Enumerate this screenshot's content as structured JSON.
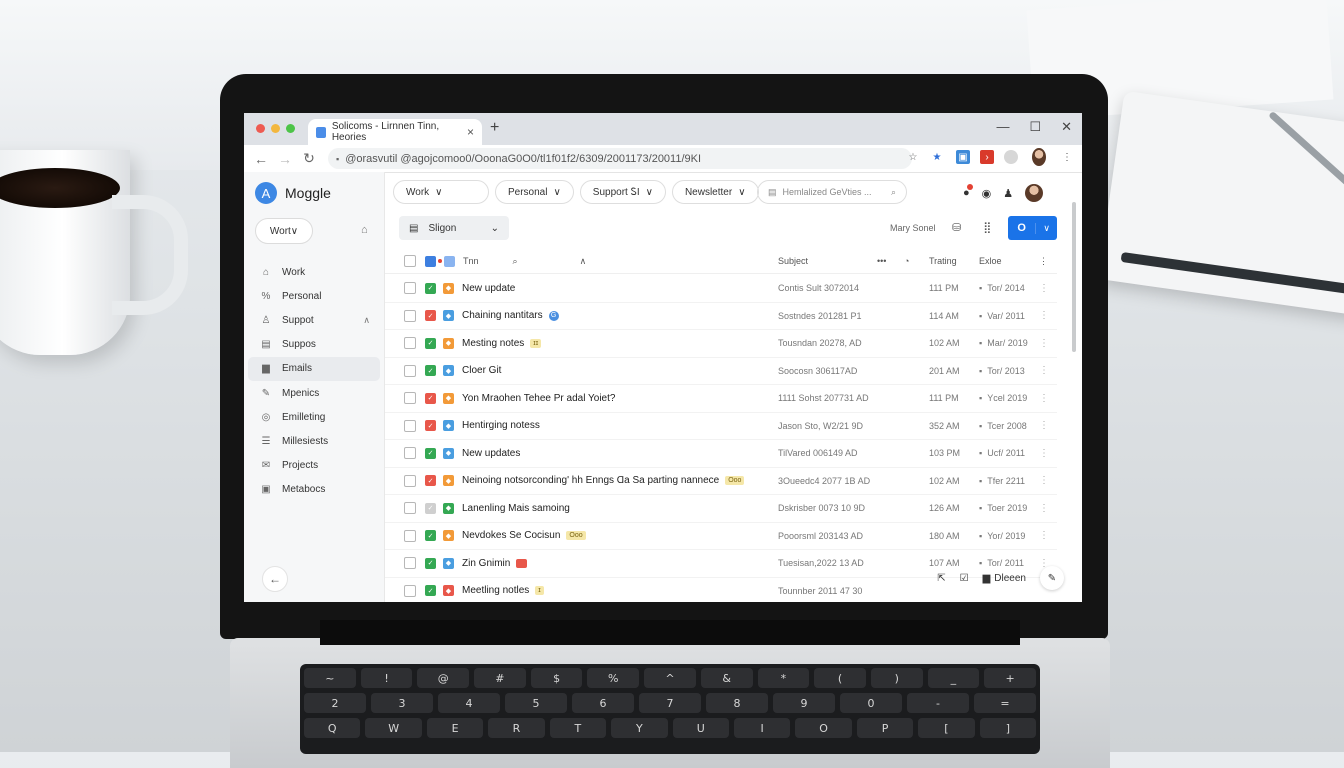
{
  "browser": {
    "tab_title": "Solicoms - Lirnnen Tinn, Heories",
    "tab_close": "×",
    "new_tab": "+",
    "address": "@orasvutil @agojcomoo0/OoonaG0O0/tl1f01f2/6309/2001173/20011/9KI",
    "window_controls": [
      "—",
      "☐",
      "✕"
    ]
  },
  "sidebar": {
    "brand_letter": "A",
    "brand_name": "Moggle",
    "account_label": "Wort∨",
    "items": [
      {
        "label": "Work",
        "icon": "⌂"
      },
      {
        "label": "Personal",
        "icon": "%"
      },
      {
        "label": "Suppot",
        "icon": "♙",
        "chevron": "∧"
      },
      {
        "label": "Suppos",
        "icon": "▤"
      },
      {
        "label": "Emails",
        "icon": "▆"
      },
      {
        "label": "Mpenics",
        "icon": "✎"
      },
      {
        "label": "Emilleting",
        "icon": "◎"
      },
      {
        "label": "Millesiests",
        "icon": "☰"
      },
      {
        "label": "Projects",
        "icon": "✉"
      },
      {
        "label": "Metabocs",
        "icon": "▣"
      }
    ],
    "back": "←"
  },
  "filters": [
    {
      "label": "Work",
      "chev": "∨"
    },
    {
      "label": "Personal",
      "chev": "∨"
    },
    {
      "label": "Support ᏚΙ",
      "chev": "∨"
    },
    {
      "label": "Newsletter",
      "chev": "∨"
    }
  ],
  "search": {
    "placeholder": "Hemlalized GeVties ..."
  },
  "toolbar": {
    "label": "Sligon",
    "may_send": "Mary Sonel",
    "primary_label": "O",
    "primary_chev": "∨"
  },
  "table": {
    "headers": {
      "name": "Tnn",
      "subject": "Subject",
      "date": "Trating",
      "expires": "Exloe"
    },
    "rows": [
      {
        "subject": "New update",
        "date": "Contis Sult 3072014",
        "time": "111 PM",
        "exp": "Tor/ 2014",
        "c1": "#34a853",
        "c2": "#f29a38"
      },
      {
        "subject": "Chaining nantitars",
        "date": "Sostndes 201281 P1",
        "time": "114 AM",
        "exp": "Var/ 2011",
        "c1": "#e8574a",
        "c2": "#4a9ee0"
      },
      {
        "subject": "Mesting notes",
        "date": "Tousndan 20278, AD",
        "time": "102 AM",
        "exp": "Mar/ 2019",
        "c1": "#34a853",
        "c2": "#f29a38"
      },
      {
        "subject": "Cloer Git",
        "date": "Soocosn 306117AD",
        "time": "201 AM",
        "exp": "Tor/ 2013",
        "c1": "#34a853",
        "c2": "#4a9ee0"
      },
      {
        "subject": "Yon Mraohen Tehee Pr adal Yoiet?",
        "date": "1111 Sohst 207731 AD",
        "time": "111 PM",
        "exp": "Ycel 2019",
        "c1": "#e8574a",
        "c2": "#f29a38"
      },
      {
        "subject": "Hentirging notess",
        "date": "Jason Sto, W2/21 9D",
        "time": "352 AM",
        "exp": "Tcer 2008",
        "c1": "#e8574a",
        "c2": "#4a9ee0"
      },
      {
        "subject": "New updates",
        "date": "TilVared 006149 AD",
        "time": "103 PM",
        "exp": "Ucf/ 2011",
        "c1": "#34a853",
        "c2": "#4a9ee0"
      },
      {
        "subject": "Neinoing notsorconding' hh Enngs Ɑa Sa parting nannece",
        "date": "3Oueedc4 2077 1B AD",
        "time": "102 AM",
        "exp": "Tfer 2211",
        "c1": "#e8574a",
        "c2": "#f29a38"
      },
      {
        "subject": "Lanenling Mais samoing",
        "date": "Dskrisber 0073 10 9D",
        "time": "126 AM",
        "exp": "Toer 2019",
        "c1": "#cfcfcf",
        "c2": "#34a853"
      },
      {
        "subject": "Nevdokes Se Cocisun",
        "date": "Pooorsml 203143 AD",
        "time": "180 AM",
        "exp": "Yor/ 2019",
        "c1": "#34a853",
        "c2": "#f29a38"
      },
      {
        "subject": "Zin Gnimin",
        "date": "Tuesisan,2022 13 AD",
        "time": "107 AM",
        "exp": "Tor/ 2011",
        "c1": "#34a853",
        "c2": "#4a9ee0"
      },
      {
        "subject": "Meetling notles",
        "date": "Tounnber 2011 47 30",
        "time": "",
        "exp": "",
        "c1": "#34a853",
        "c2": "#e8574a"
      }
    ]
  },
  "action_bar": {
    "archive": "Dleeen"
  },
  "keyboard": {
    "row1": [
      "~",
      "!",
      "@",
      "#",
      "$",
      "%",
      "^",
      "&",
      "*",
      "(",
      ")",
      "_",
      "+"
    ],
    "row2": [
      "2",
      "3",
      "4",
      "5",
      "6",
      "7",
      "8",
      "9",
      "0",
      "-",
      "="
    ],
    "row3": [
      "Q",
      "W",
      "E",
      "R",
      "T",
      "Y",
      "U",
      "I",
      "O",
      "P",
      "[",
      "]"
    ]
  }
}
